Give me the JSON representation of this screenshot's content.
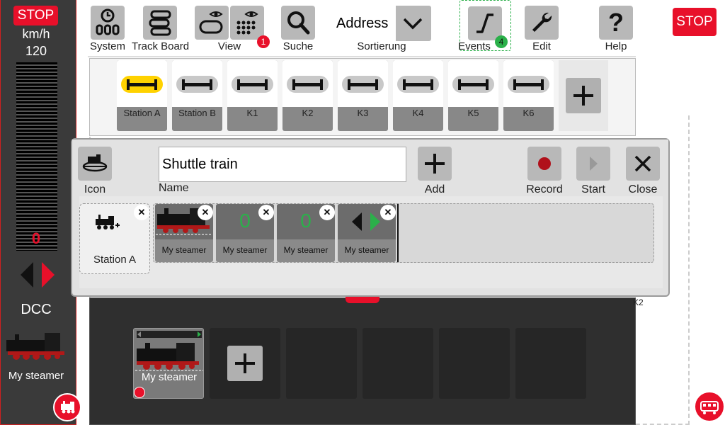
{
  "throttle": {
    "stop_label": "STOP",
    "unit": "km/h",
    "max_speed": "120",
    "current_speed": "0",
    "protocol": "DCC",
    "loco_name": "My steamer",
    "direction": "forward",
    "accent": "#e8102a"
  },
  "toolbar": {
    "system": "System",
    "track_board": "Track Board",
    "view": "View",
    "view_badge": "1",
    "search": "Suche",
    "sort_value": "Address",
    "sort_label": "Sortierung",
    "events": "Events",
    "events_badge": "4",
    "edit": "Edit",
    "help": "Help",
    "stop": "STOP"
  },
  "stations": {
    "items": [
      {
        "label": "Station A",
        "active": true
      },
      {
        "label": "Station B",
        "active": false
      },
      {
        "label": "K1",
        "active": false
      },
      {
        "label": "K2",
        "active": false
      },
      {
        "label": "K3",
        "active": false
      },
      {
        "label": "K4",
        "active": false
      },
      {
        "label": "K5",
        "active": false
      },
      {
        "label": "K6",
        "active": false
      }
    ]
  },
  "dialog": {
    "icon_label": "Icon",
    "name_label": "Name",
    "name_value": "Shuttle train",
    "add_label": "Add",
    "record_label": "Record",
    "start_label": "Start",
    "close_label": "Close",
    "start_station": "Station A",
    "sequence": [
      {
        "type": "loco",
        "label": "My steamer"
      },
      {
        "type": "speed",
        "value": "0",
        "label": "My steamer"
      },
      {
        "type": "speed",
        "value": "0",
        "label": "My steamer"
      },
      {
        "type": "direction",
        "label": "My steamer"
      }
    ]
  },
  "layout": {
    "k2_label": "K2",
    "bottom_loco": "My steamer"
  }
}
